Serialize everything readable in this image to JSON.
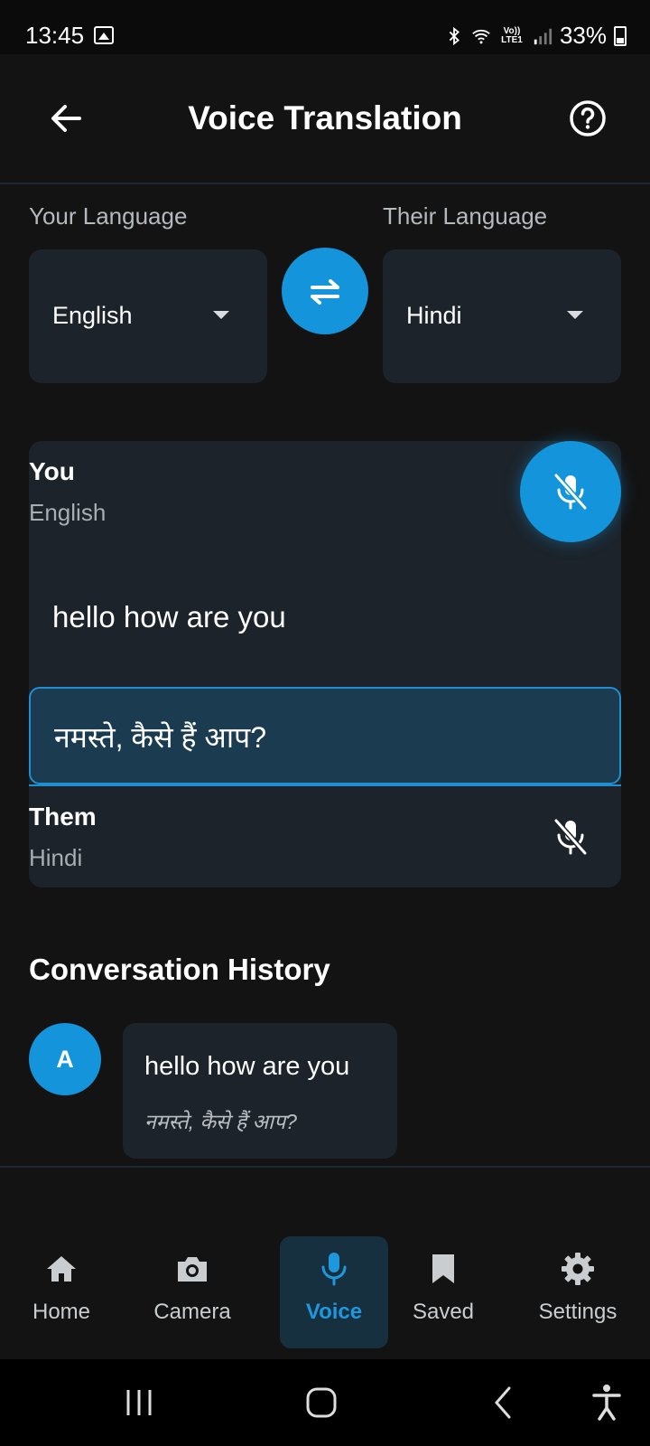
{
  "status_bar": {
    "time": "13:45",
    "network_label": "Vo)) LTE1",
    "battery": "33%"
  },
  "header": {
    "title": "Voice Translation",
    "back_icon": "arrow-left-icon",
    "help_icon": "help-circle-icon"
  },
  "languages": {
    "your_label": "Your Language",
    "their_label": "Their Language",
    "your_value": "English",
    "their_value": "Hindi"
  },
  "translation": {
    "you_title": "You",
    "you_lang": "English",
    "source_text": "hello how are you",
    "target_text": "नमस्ते, कैसे हैं आप?",
    "them_title": "Them",
    "them_lang": "Hindi"
  },
  "history": {
    "title": "Conversation History",
    "items": [
      {
        "avatar": "A",
        "original": "hello how are you",
        "translated": "नमस्ते, कैसे हैं आप?"
      }
    ]
  },
  "bottom_nav": {
    "items": [
      {
        "label": "Home",
        "icon": "home-icon"
      },
      {
        "label": "Camera",
        "icon": "camera-icon"
      },
      {
        "label": "Voice",
        "icon": "mic-icon",
        "active": true
      },
      {
        "label": "Saved",
        "icon": "bookmark-icon"
      },
      {
        "label": "Settings",
        "icon": "gear-icon"
      }
    ]
  },
  "colors": {
    "accent": "#1495db",
    "background": "#131313",
    "card": "#1c232a",
    "target_box": "#1b3b50"
  }
}
